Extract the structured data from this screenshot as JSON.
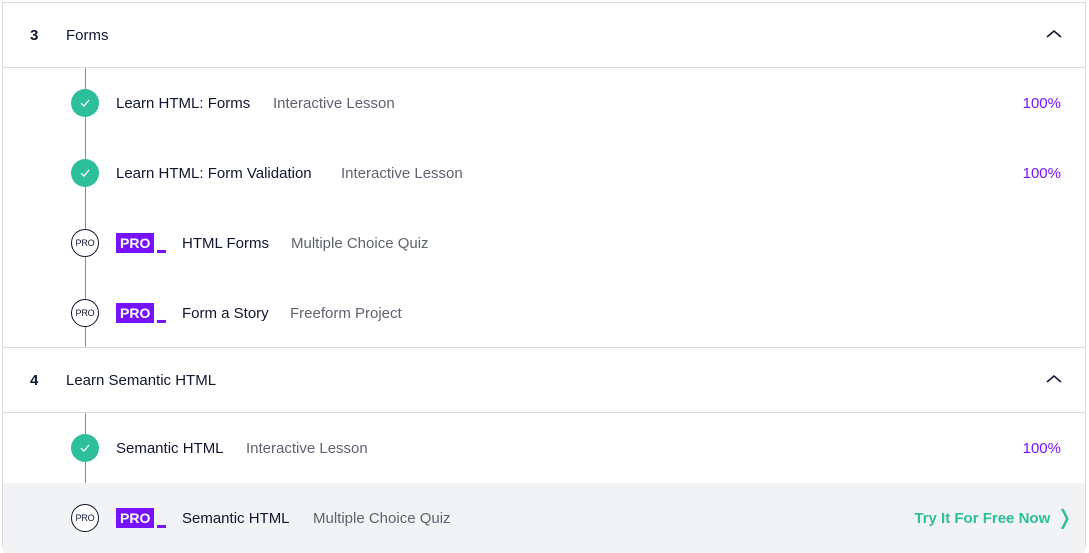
{
  "modules": [
    {
      "number": "3",
      "title": "Forms",
      "items": [
        {
          "title": "Learn HTML: Forms",
          "type": "Interactive Lesson",
          "progress": "100%",
          "status": "done"
        },
        {
          "title": "Learn HTML: Form Validation",
          "type": "Interactive Lesson",
          "progress": "100%",
          "status": "done"
        },
        {
          "title": "HTML Forms",
          "type": "Multiple Choice Quiz",
          "status": "locked",
          "pro": "PRO",
          "locked_label": "PRO"
        },
        {
          "title": "Form a Story",
          "type": "Freeform Project",
          "status": "locked",
          "pro": "PRO",
          "locked_label": "PRO"
        }
      ]
    },
    {
      "number": "4",
      "title": "Learn Semantic HTML",
      "items": [
        {
          "title": "Semantic HTML",
          "type": "Interactive Lesson",
          "progress": "100%",
          "status": "done"
        },
        {
          "title": "Semantic HTML",
          "type": "Multiple Choice Quiz",
          "status": "locked",
          "pro": "PRO",
          "locked_label": "PRO",
          "cta": "Try It For Free Now",
          "cta_arrow": "❭"
        }
      ]
    }
  ],
  "colors": {
    "accent_purple": "#7612ff",
    "complete_green": "#2dbf9b",
    "text_dark": "#10162f",
    "text_muted": "#5f6370"
  }
}
